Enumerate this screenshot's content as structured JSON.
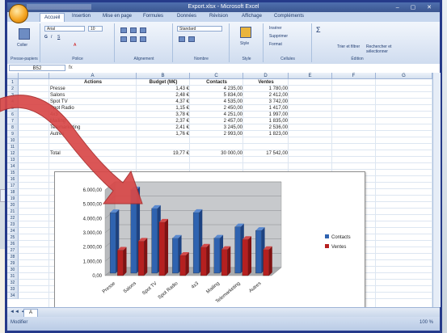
{
  "window": {
    "title": "Export.xlsx - Microsoft Excel"
  },
  "ribbon": {
    "tabs": [
      "Accueil",
      "Insertion",
      "Mise en page",
      "Formules",
      "Données",
      "Révision",
      "Affichage",
      "Compléments"
    ],
    "active_tab": "Accueil",
    "groups": [
      "Presse-papiers",
      "Police",
      "Alignement",
      "Nombre",
      "Style",
      "Cellules",
      "Édition"
    ],
    "paste_label": "Coller",
    "font_name": "Arial",
    "font_size": "10",
    "number_format": "Standard",
    "style_label": "Style",
    "insert_label": "Insérer",
    "delete_label": "Supprimer",
    "format_label": "Format",
    "sort_label": "Trier et filtrer",
    "find_label": "Rechercher et sélectionner"
  },
  "formula_bar": {
    "name_box": "B52",
    "fx": "fx"
  },
  "sheet": {
    "columns": [
      "A",
      "B",
      "C",
      "D",
      "E",
      "F",
      "G"
    ],
    "row_numbers": [
      "1",
      "2",
      "3",
      "4",
      "5",
      "6",
      "7",
      "8",
      "9",
      "10",
      "11",
      "12",
      "13",
      "14",
      "15",
      "16",
      "17",
      "18",
      "19",
      "20",
      "21",
      "22",
      "23",
      "24",
      "25",
      "26",
      "27",
      "28",
      "29",
      "30",
      "31",
      "32",
      "33",
      "34"
    ],
    "headers": [
      "Actions",
      "Budget (M€)",
      "Contacts",
      "Ventes"
    ],
    "rows": [
      [
        "Presse",
        "1,43 €",
        "4 235,00",
        "1 780,00"
      ],
      [
        "Salons",
        "2,48 €",
        "5 834,00",
        "2 412,00"
      ],
      [
        "Spot TV",
        "4,37 €",
        "4 535,00",
        "3 742,00"
      ],
      [
        "Spot Radio",
        "1,15 €",
        "2 450,00",
        "1 417,00"
      ],
      [
        "4x3",
        "3,78 €",
        "4 251,00",
        "1 997,00"
      ],
      [
        "Mailing",
        "2,37 €",
        "2 457,00",
        "1 835,00"
      ],
      [
        "Telemarketing",
        "2,41 €",
        "3 245,00",
        "2 536,00"
      ],
      [
        "Autres",
        "1,76 €",
        "2 993,00",
        "1 823,00"
      ]
    ],
    "total": [
      "Total",
      "19,77 €",
      "30 000,00",
      "17 542,00"
    ],
    "tab_name": "A",
    "status": "Modifier",
    "zoom": "100 %"
  },
  "chart_data": {
    "type": "bar",
    "categories": [
      "Presse",
      "Salons",
      "Spot TV",
      "Spot Radio",
      "4x3",
      "Mailing",
      "Telemarketing",
      "Autres"
    ],
    "series": [
      {
        "name": "Contacts",
        "values": [
          4235,
          5834,
          4535,
          2450,
          4251,
          2457,
          3245,
          2993
        ]
      },
      {
        "name": "Ventes",
        "values": [
          1780,
          2412,
          3742,
          1417,
          1997,
          1835,
          2536,
          1823
        ]
      }
    ],
    "yticks": [
      "0,00",
      "1.000,00",
      "2.000,00",
      "3.000,00",
      "4.000,00",
      "5.000,00",
      "6.000,00"
    ],
    "ylim": [
      0,
      6000
    ],
    "legend": "right",
    "colors": {
      "Contacts": "#2f63b0",
      "Ventes": "#b52020"
    },
    "title": "",
    "xlabel": "",
    "ylabel": ""
  },
  "colors": {
    "accent": "#253a8a",
    "arrow": "#d84848"
  }
}
